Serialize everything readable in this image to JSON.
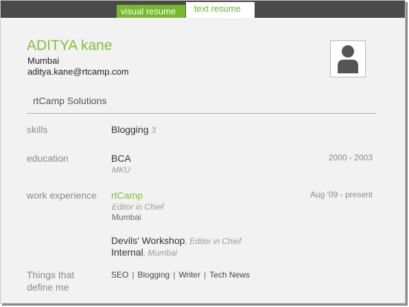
{
  "tabs": {
    "visual": "visual resume",
    "text": "text resume"
  },
  "profile": {
    "name": "ADITYA kane",
    "city": "Mumbai",
    "email": "aditya.kane@rtcamp.com",
    "company": "rtCamp Solutions"
  },
  "skills": {
    "label": "skills",
    "value": "Blogging",
    "count": "3"
  },
  "education": {
    "label": "education",
    "degree": "BCA",
    "school": "MKU",
    "dates": "2000 - 2003"
  },
  "work": {
    "label": "work experience",
    "jobs": [
      {
        "company": "rtCamp",
        "role": "Editor in Chief",
        "location": "Mumbai",
        "dates": "Aug '09 - present"
      },
      {
        "company": "Devils' Workshop",
        "separator": ", ",
        "role": "Editor in Chief",
        "org": "Internal",
        "location": "Mumbai"
      }
    ]
  },
  "defines": {
    "label_line1": "Things that",
    "label_line2": "define me",
    "items": [
      "SEO",
      "Blogging",
      "Writer",
      "Tech News"
    ],
    "separator": "|"
  },
  "colors": {
    "accent": "#7fc23a",
    "topbar": "#4a4a4a"
  },
  "icons": {
    "avatar": "user-silhouette-icon"
  }
}
